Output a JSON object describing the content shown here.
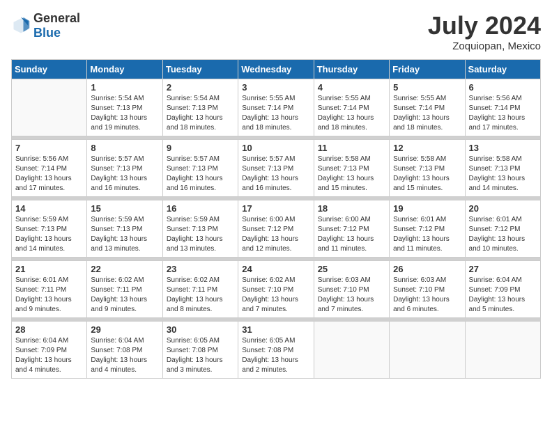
{
  "header": {
    "logo_general": "General",
    "logo_blue": "Blue",
    "month": "July 2024",
    "location": "Zoquiopan, Mexico"
  },
  "weekdays": [
    "Sunday",
    "Monday",
    "Tuesday",
    "Wednesday",
    "Thursday",
    "Friday",
    "Saturday"
  ],
  "weeks": [
    [
      {
        "day": "",
        "info": ""
      },
      {
        "day": "1",
        "info": "Sunrise: 5:54 AM\nSunset: 7:13 PM\nDaylight: 13 hours\nand 19 minutes."
      },
      {
        "day": "2",
        "info": "Sunrise: 5:54 AM\nSunset: 7:13 PM\nDaylight: 13 hours\nand 18 minutes."
      },
      {
        "day": "3",
        "info": "Sunrise: 5:55 AM\nSunset: 7:14 PM\nDaylight: 13 hours\nand 18 minutes."
      },
      {
        "day": "4",
        "info": "Sunrise: 5:55 AM\nSunset: 7:14 PM\nDaylight: 13 hours\nand 18 minutes."
      },
      {
        "day": "5",
        "info": "Sunrise: 5:55 AM\nSunset: 7:14 PM\nDaylight: 13 hours\nand 18 minutes."
      },
      {
        "day": "6",
        "info": "Sunrise: 5:56 AM\nSunset: 7:14 PM\nDaylight: 13 hours\nand 17 minutes."
      }
    ],
    [
      {
        "day": "7",
        "info": "Sunrise: 5:56 AM\nSunset: 7:14 PM\nDaylight: 13 hours\nand 17 minutes."
      },
      {
        "day": "8",
        "info": "Sunrise: 5:57 AM\nSunset: 7:13 PM\nDaylight: 13 hours\nand 16 minutes."
      },
      {
        "day": "9",
        "info": "Sunrise: 5:57 AM\nSunset: 7:13 PM\nDaylight: 13 hours\nand 16 minutes."
      },
      {
        "day": "10",
        "info": "Sunrise: 5:57 AM\nSunset: 7:13 PM\nDaylight: 13 hours\nand 16 minutes."
      },
      {
        "day": "11",
        "info": "Sunrise: 5:58 AM\nSunset: 7:13 PM\nDaylight: 13 hours\nand 15 minutes."
      },
      {
        "day": "12",
        "info": "Sunrise: 5:58 AM\nSunset: 7:13 PM\nDaylight: 13 hours\nand 15 minutes."
      },
      {
        "day": "13",
        "info": "Sunrise: 5:58 AM\nSunset: 7:13 PM\nDaylight: 13 hours\nand 14 minutes."
      }
    ],
    [
      {
        "day": "14",
        "info": "Sunrise: 5:59 AM\nSunset: 7:13 PM\nDaylight: 13 hours\nand 14 minutes."
      },
      {
        "day": "15",
        "info": "Sunrise: 5:59 AM\nSunset: 7:13 PM\nDaylight: 13 hours\nand 13 minutes."
      },
      {
        "day": "16",
        "info": "Sunrise: 5:59 AM\nSunset: 7:13 PM\nDaylight: 13 hours\nand 13 minutes."
      },
      {
        "day": "17",
        "info": "Sunrise: 6:00 AM\nSunset: 7:12 PM\nDaylight: 13 hours\nand 12 minutes."
      },
      {
        "day": "18",
        "info": "Sunrise: 6:00 AM\nSunset: 7:12 PM\nDaylight: 13 hours\nand 11 minutes."
      },
      {
        "day": "19",
        "info": "Sunrise: 6:01 AM\nSunset: 7:12 PM\nDaylight: 13 hours\nand 11 minutes."
      },
      {
        "day": "20",
        "info": "Sunrise: 6:01 AM\nSunset: 7:12 PM\nDaylight: 13 hours\nand 10 minutes."
      }
    ],
    [
      {
        "day": "21",
        "info": "Sunrise: 6:01 AM\nSunset: 7:11 PM\nDaylight: 13 hours\nand 9 minutes."
      },
      {
        "day": "22",
        "info": "Sunrise: 6:02 AM\nSunset: 7:11 PM\nDaylight: 13 hours\nand 9 minutes."
      },
      {
        "day": "23",
        "info": "Sunrise: 6:02 AM\nSunset: 7:11 PM\nDaylight: 13 hours\nand 8 minutes."
      },
      {
        "day": "24",
        "info": "Sunrise: 6:02 AM\nSunset: 7:10 PM\nDaylight: 13 hours\nand 7 minutes."
      },
      {
        "day": "25",
        "info": "Sunrise: 6:03 AM\nSunset: 7:10 PM\nDaylight: 13 hours\nand 7 minutes."
      },
      {
        "day": "26",
        "info": "Sunrise: 6:03 AM\nSunset: 7:10 PM\nDaylight: 13 hours\nand 6 minutes."
      },
      {
        "day": "27",
        "info": "Sunrise: 6:04 AM\nSunset: 7:09 PM\nDaylight: 13 hours\nand 5 minutes."
      }
    ],
    [
      {
        "day": "28",
        "info": "Sunrise: 6:04 AM\nSunset: 7:09 PM\nDaylight: 13 hours\nand 4 minutes."
      },
      {
        "day": "29",
        "info": "Sunrise: 6:04 AM\nSunset: 7:08 PM\nDaylight: 13 hours\nand 4 minutes."
      },
      {
        "day": "30",
        "info": "Sunrise: 6:05 AM\nSunset: 7:08 PM\nDaylight: 13 hours\nand 3 minutes."
      },
      {
        "day": "31",
        "info": "Sunrise: 6:05 AM\nSunset: 7:08 PM\nDaylight: 13 hours\nand 2 minutes."
      },
      {
        "day": "",
        "info": ""
      },
      {
        "day": "",
        "info": ""
      },
      {
        "day": "",
        "info": ""
      }
    ]
  ]
}
